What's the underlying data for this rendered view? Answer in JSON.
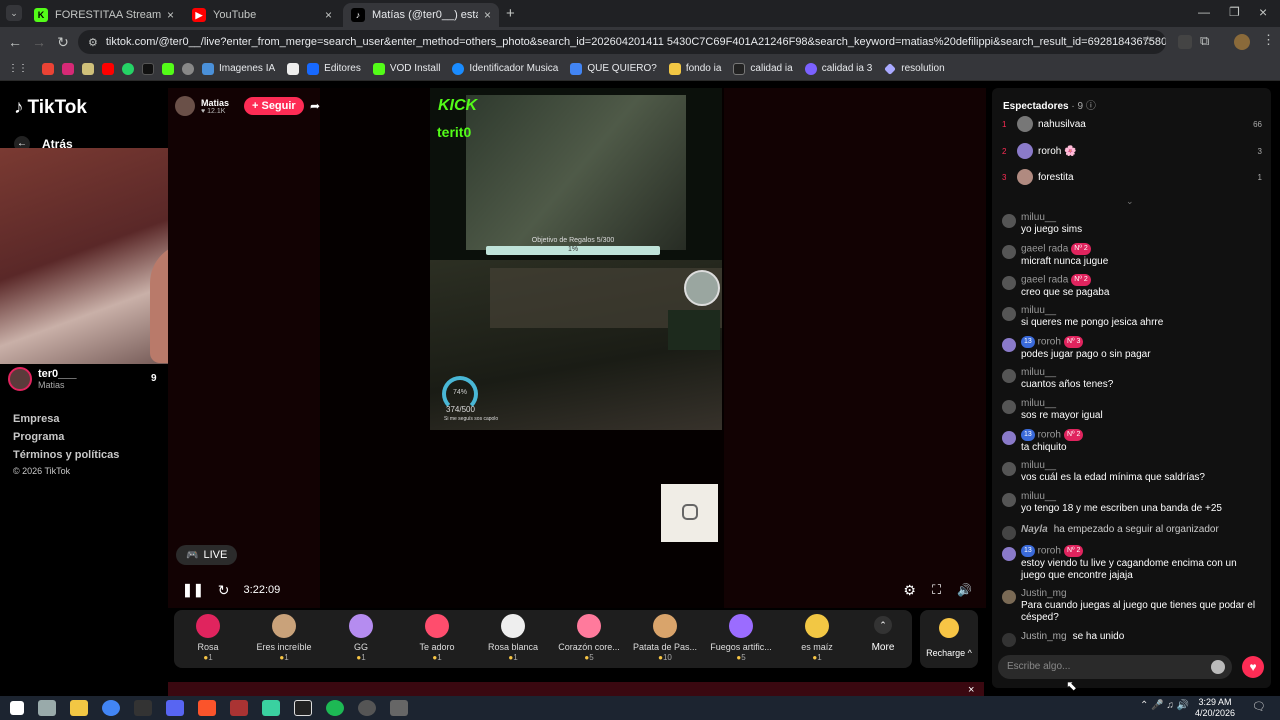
{
  "browser": {
    "tabs": [
      {
        "label": "FORESTITAA Stream - Watch Li",
        "color": "#53fc18",
        "glyph": "K"
      },
      {
        "label": "YouTube",
        "color": "#ff0000",
        "glyph": "▶"
      },
      {
        "label": "Matías (@ter0__) está emi",
        "color": "#000000",
        "glyph": "♪"
      }
    ],
    "url": "tiktok.com/@ter0__/live?enter_from_merge=search_user&enter_method=others_photo&search_id=202604201411 5430C7C69F401A21246F98&search_keyword=matias%20defilippi&search_result_id=6928184367580480518&search_type=user",
    "bookmarks": [
      "Imagenes IA",
      "Editores",
      "VOD Install",
      "Identificador Musica",
      "QUE QUIERO?",
      "fondo ia",
      "calidad ia",
      "calidad ia 3",
      "resolution"
    ]
  },
  "tiktok": {
    "logo": "TikTok",
    "back": "Atrás",
    "host": {
      "handle": "ter0___",
      "name": "Matias",
      "viewers": "9"
    },
    "streamer": {
      "name": "Matias",
      "likes": "♥ 12.1K",
      "follow": "+ Seguir"
    },
    "footer": [
      "Empresa",
      "Programa",
      "Términos y políticas",
      "© 2026 TikTok"
    ],
    "overlay": {
      "kick": "KICK",
      "kick_user": "terit0",
      "goal": "Objetivo de Regalos 5/300",
      "goal_pct": "1%",
      "gauge": "74%",
      "gauge_sub": "374/500",
      "gauge_note": "Si me seguís sos capolo"
    },
    "live": "LIVE",
    "time": "3:22:09",
    "gifts": [
      {
        "name": "Rosa",
        "price": "1",
        "color": "#e0245e"
      },
      {
        "name": "Eres increíble",
        "price": "1",
        "color": "#c9a27a"
      },
      {
        "name": "GG",
        "price": "1",
        "color": "#b58cf0"
      },
      {
        "name": "Te adoro",
        "price": "1",
        "color": "#ff4d6d"
      },
      {
        "name": "Rosa blanca",
        "price": "1",
        "color": "#eeeeee"
      },
      {
        "name": "Corazón core...",
        "price": "5",
        "color": "#ff7a9c"
      },
      {
        "name": "Patata de Pas...",
        "price": "10",
        "color": "#d9a46b"
      },
      {
        "name": "Fuegos artific...",
        "price": "5",
        "color": "#9b6cff"
      },
      {
        "name": "es maíz",
        "price": "1",
        "color": "#f2c744"
      }
    ],
    "more": "More",
    "recharge": "Recharge ^"
  },
  "chat": {
    "title": "Espectadores",
    "count": "· 9",
    "viewers": [
      {
        "rank": "1",
        "name": "nahusilvaa",
        "score": "66"
      },
      {
        "rank": "2",
        "name": "roroh 🌸",
        "score": "3"
      },
      {
        "rank": "3",
        "name": "forestita",
        "score": "1"
      }
    ],
    "messages": [
      {
        "name": "miluu__",
        "text": "yo juego sims",
        "badge": ""
      },
      {
        "name": "gaeel rada",
        "text": "micraft nunca jugue",
        "badge": "Nº 2"
      },
      {
        "name": "gaeel rada",
        "text": "creo que se pagaba",
        "badge": "Nº 2"
      },
      {
        "name": "miluu__",
        "text": "si queres me pongo jesica ahrre",
        "badge": ""
      },
      {
        "name": "roroh",
        "text": "podes jugar pago o sin pagar",
        "badge": "Nº 3"
      },
      {
        "name": "miluu__",
        "text": "cuantos años tenes?",
        "badge": ""
      },
      {
        "name": "miluu__",
        "text": "sos re mayor igual",
        "badge": ""
      },
      {
        "name": "roroh",
        "text": "ta chiquito",
        "badge": "Nº 2"
      },
      {
        "name": "miluu__",
        "text": "vos cuál es la edad mínima que saldrías?",
        "badge": ""
      },
      {
        "name": "miluu__",
        "text": "yo tengo 18 y me escriben una banda de +25",
        "badge": ""
      },
      {
        "name": "Nayla",
        "text": "ha empezado a seguir al organizador",
        "badge": ""
      },
      {
        "name": "roroh",
        "text": "estoy viendo tu live y cagandome encima con un juego que encontre jajaja",
        "badge": "Nº 2"
      },
      {
        "name": "Justin_mg",
        "text": "Para cuando juegas al juego que tienes que podar el césped?",
        "badge": ""
      },
      {
        "name": "Justin_mg",
        "text": "se ha unido",
        "badge": ""
      }
    ],
    "placeholder": "Escribe algo..."
  },
  "taskbar": {
    "time": "3:29 AM",
    "date": "4/20/2026"
  }
}
